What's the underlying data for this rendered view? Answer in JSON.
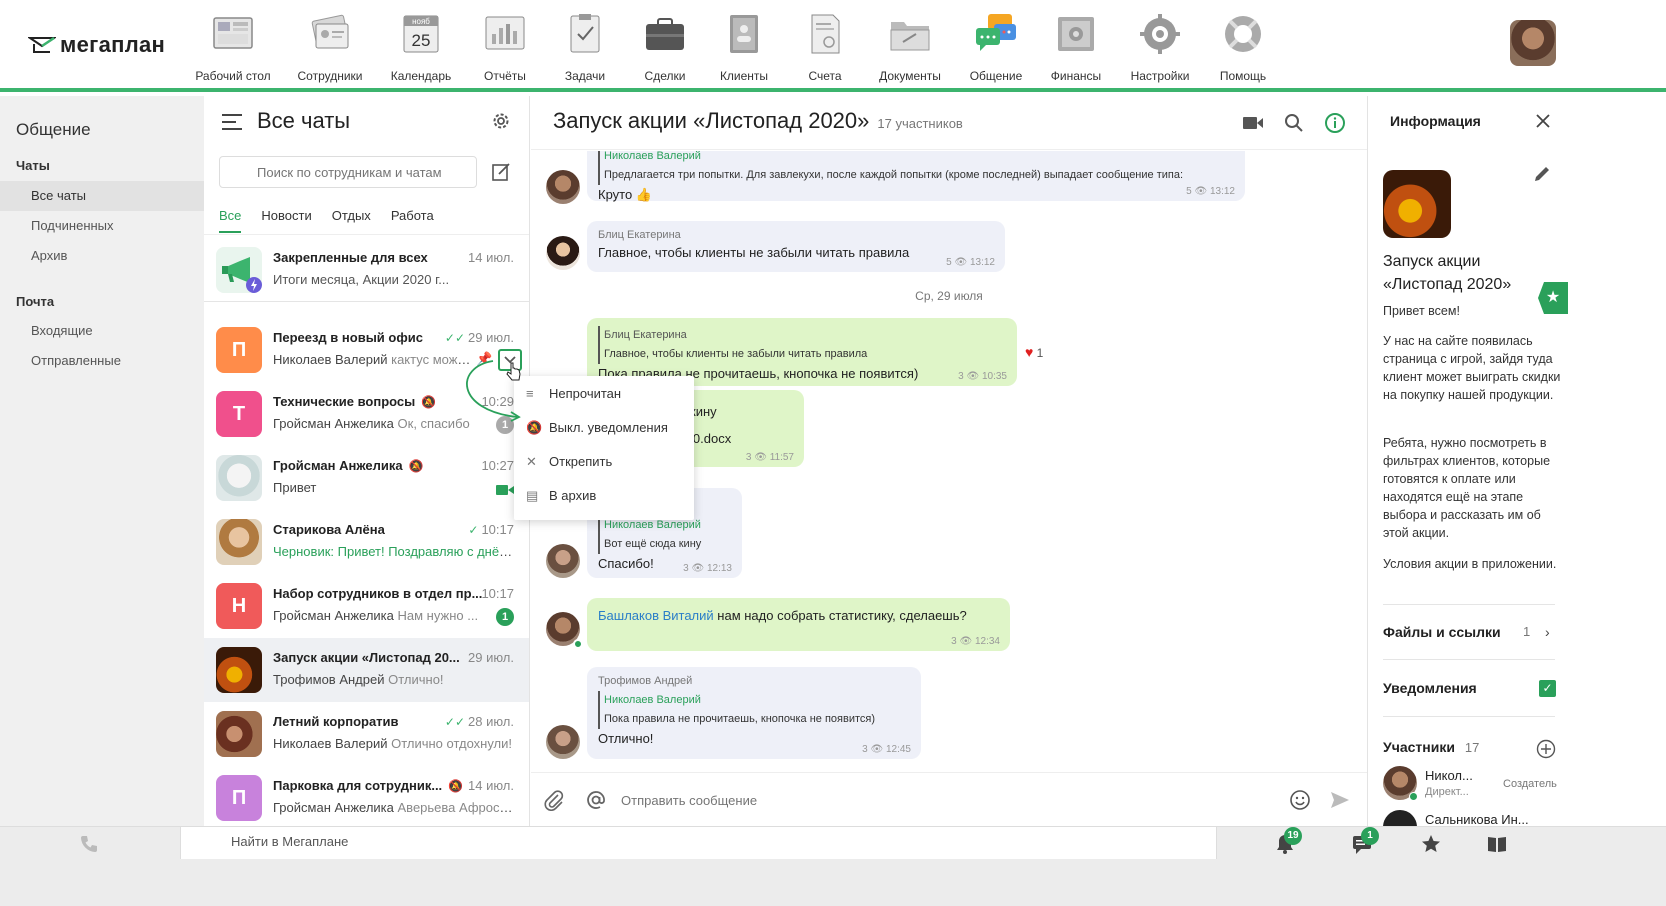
{
  "brand": {
    "logo_text": "мегаплан",
    "accent": "#3cb46e"
  },
  "nav": [
    {
      "label": "Рабочий стол",
      "icon": "desktop-icon"
    },
    {
      "label": "Сотрудники",
      "icon": "employees-icon"
    },
    {
      "label": "Календарь",
      "icon": "calendar-icon",
      "cal_month": "нояб",
      "cal_day": "25"
    },
    {
      "label": "Отчёты",
      "icon": "reports-icon"
    },
    {
      "label": "Задачи",
      "icon": "tasks-icon"
    },
    {
      "label": "Сделки",
      "icon": "deals-icon"
    },
    {
      "label": "Клиенты",
      "icon": "clients-icon"
    },
    {
      "label": "Счета",
      "icon": "invoices-icon"
    },
    {
      "label": "Документы",
      "icon": "documents-icon"
    },
    {
      "label": "Общение",
      "icon": "communication-icon",
      "active": true
    },
    {
      "label": "Финансы",
      "icon": "finance-icon"
    },
    {
      "label": "Настройки",
      "icon": "settings-icon"
    },
    {
      "label": "Помощь",
      "icon": "help-icon"
    }
  ],
  "sidebar": {
    "title": "Общение",
    "chats_group": "Чаты",
    "chats_items": [
      "Все чаты",
      "Подчиненных",
      "Архив"
    ],
    "mail_group": "Почта",
    "mail_items": [
      "Входящие",
      "Отправленные"
    ]
  },
  "chatlist": {
    "title": "Все чаты",
    "search_placeholder": "Поиск по сотрудникам и чатам",
    "tabs": [
      "Все",
      "Новости",
      "Отдых",
      "Работа"
    ],
    "chats": [
      {
        "name": "Закрепленные для всех",
        "time": "14 июл.",
        "preview": "Итоги месяца, Акции 2020 г...",
        "avatar_color": "#3cb46e"
      },
      {
        "name": "Переезд в новый офис",
        "time": "29 июл.",
        "author": "Николаев Валерий",
        "preview": "кактус можно...",
        "avatar_letter": "П",
        "avatar_color": "#ff8c4a",
        "read": true
      },
      {
        "name": "Технические вопросы",
        "time": "10:29",
        "author": "Гройсман Анжелика",
        "preview": "Ок, спасибо",
        "avatar_letter": "Т",
        "avatar_color": "#f0508c",
        "muted": true,
        "badge": "1"
      },
      {
        "name": "Гройсман Анжелика",
        "time": "10:27",
        "preview": "Привет",
        "muted": true
      },
      {
        "name": "Старикова Алёна",
        "time": "10:17",
        "draft_label": "Черновик:",
        "preview": "Привет! Поздравляю с днём...",
        "read": true
      },
      {
        "name": "Набор сотрудников в отдел пр...",
        "time": "10:17",
        "author": "Гройсман Анжелика",
        "preview": "Нам нужно ...",
        "avatar_letter": "Н",
        "avatar_color": "#f05a5a",
        "badge": "1"
      },
      {
        "name": "Запуск акции «Листопад 20...",
        "time": "29 июл.",
        "author": "Трофимов Андрей",
        "preview": "Отлично!"
      },
      {
        "name": "Летний корпоратив",
        "time": "28 июл.",
        "author": "Николаев Валерий",
        "preview": "Отлично отдохнули!",
        "read": true
      },
      {
        "name": "Парковка для сотрудник...",
        "time": "14 июл.",
        "author": "Гройсман Анжелика",
        "preview": "Аверьева Афросиния...",
        "avatar_letter": "П",
        "avatar_color": "#c882dc",
        "muted": true
      }
    ]
  },
  "context_menu": [
    "Непрочитан",
    "Выкл. уведомления",
    "Открепить",
    "В архив"
  ],
  "chat": {
    "title": "Запуск акции «Листопад 2020»",
    "participants": "17 участников",
    "date_separator": "Ср, 29 июля",
    "messages": [
      {
        "quote_author": "Николаев Валерий",
        "quote_text": "Предлагается три попытки. Для завлекухи, после каждой попытки (кроме последней) выпадает сообщение типа:",
        "text": "Круто 👍",
        "views": "5",
        "time": "13:12"
      },
      {
        "author": "Блиц Екатерина",
        "text": "Главное, чтобы клиенты не забыли читать правила",
        "views": "5",
        "time": "13:12"
      },
      {
        "quote_author": "Блиц Екатерина",
        "quote_text": "Главное, чтобы клиенты не забыли читать правила",
        "text": "Пока правила не прочитаешь, кнопочка не появится)",
        "views": "3",
        "time": "10:35",
        "reaction": "1"
      },
      {
        "text1": "кину",
        "text2": "д 2020.docx",
        "views": "3",
        "time": "11:57"
      },
      {
        "quote_author": "Николаев Валерий",
        "quote_text": "Вот ещё сюда кину",
        "text": "Спасибо!",
        "views": "3",
        "time": "12:13"
      },
      {
        "mention": "Башлаков Виталий",
        "text": "нам надо собрать статистику, сделаешь?",
        "views": "3",
        "time": "12:34"
      },
      {
        "author": "Трофимов Андрей",
        "quote_author": "Николаев Валерий",
        "quote_text": "Пока правила не прочитаешь, кнопочка не появится)",
        "text": "Отлично!",
        "views": "3",
        "time": "12:45"
      }
    ],
    "composer_placeholder": "Отправить сообщение"
  },
  "info": {
    "title": "Информация",
    "chat_name": "Запуск акции «Листопад 2020»",
    "greeting": "Привет всем!",
    "p1": "У нас на сайте появилась страница с игрой, зайдя туда клиент может выиграть скидки на покупку нашей продукции.",
    "p2": "Ребята, нужно посмотреть в фильтрах клиентов, которые готовятся к оплате или находятся ещё на этапе выбора и рассказать им об этой акции.",
    "p3": "Условия акции в приложении.",
    "files_label": "Файлы и ссылки",
    "files_count": "1",
    "notifications_label": "Уведомления",
    "participants_label": "Участники",
    "participants_count": "17",
    "members": [
      {
        "name": "Никол...",
        "role": "Директ...",
        "tag": "Создатель"
      },
      {
        "name": "Сальникова Ин..."
      }
    ]
  },
  "bottom": {
    "search_label": "Найти в Мегаплане",
    "notifications_badge": "19",
    "messages_badge": "1"
  }
}
